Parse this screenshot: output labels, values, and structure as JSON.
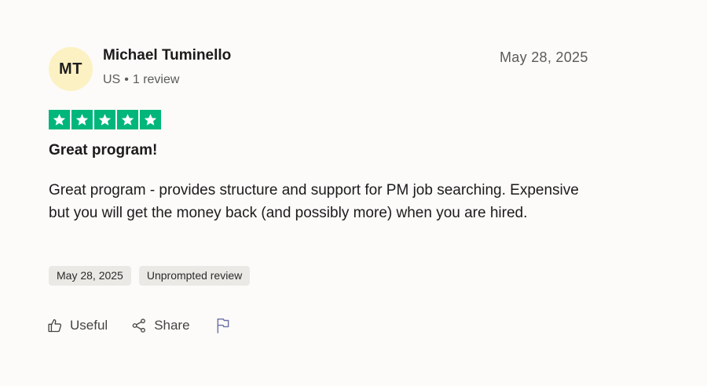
{
  "reviewer": {
    "initials": "MT",
    "name": "Michael Tuminello",
    "country": "US",
    "separator": "•",
    "review_count": "1 review"
  },
  "review": {
    "date": "May 28, 2025",
    "rating": 5,
    "rating_max": 5,
    "title": "Great program!",
    "body": "Great program - provides structure and support for PM job searching. Expensive but you will get the money back (and possibly more) when you are hired."
  },
  "tags": [
    "May 28, 2025",
    "Unprompted review"
  ],
  "actions": {
    "useful_label": "Useful",
    "share_label": "Share"
  },
  "colors": {
    "star_green": "#00b67a",
    "avatar_bg": "#fcf1c2",
    "tag_bg": "#ebe9e5",
    "flag_icon": "#6b6fa8"
  },
  "icons": {
    "useful": "thumbs-up-icon",
    "share": "share-icon",
    "flag": "flag-icon",
    "star": "star-icon"
  }
}
